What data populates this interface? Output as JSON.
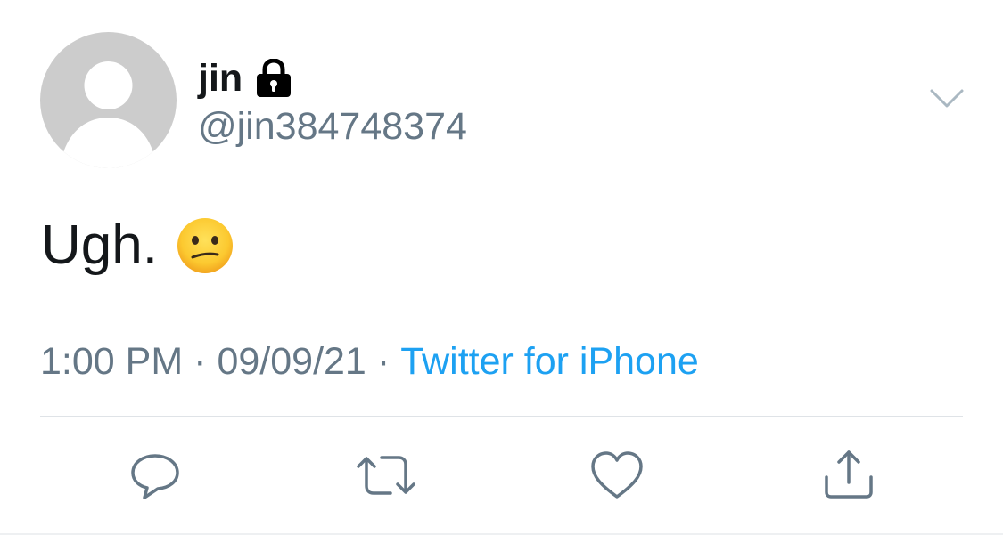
{
  "author": {
    "display_name": "jin",
    "handle": "@jin384748374",
    "protected_icon": "lock-icon",
    "avatar_icon": "default-profile-avatar"
  },
  "tweet": {
    "text": "Ugh.",
    "emoji_icon": "confused-face-emoji"
  },
  "meta": {
    "time": "1:00 PM",
    "separator": "·",
    "date": "09/09/21",
    "source": "Twitter for iPhone"
  },
  "actions": {
    "reply_icon": "reply-icon",
    "retweet_icon": "retweet-icon",
    "like_icon": "heart-icon",
    "share_icon": "share-icon"
  },
  "colors": {
    "primary_text": "#14171a",
    "secondary_text": "#657786",
    "link": "#1da1f2",
    "avatar_bg": "#cccccc",
    "divider": "#dfe3e7"
  }
}
